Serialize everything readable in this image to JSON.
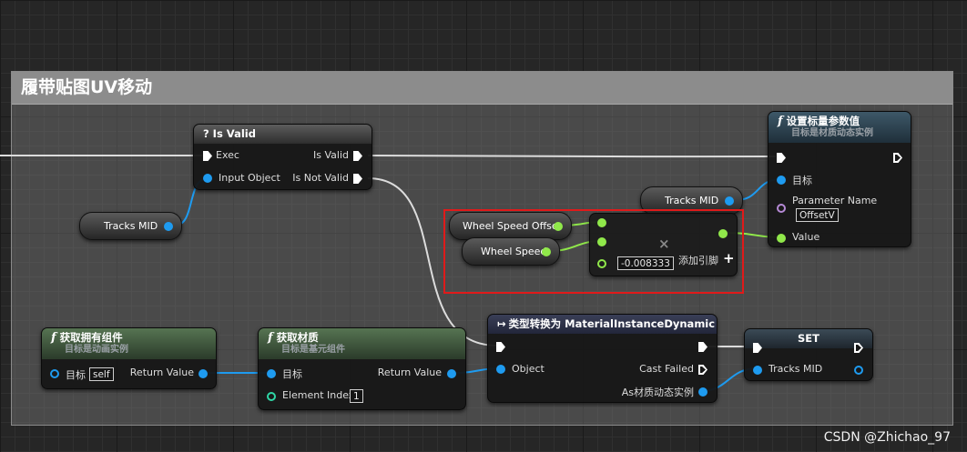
{
  "comment": {
    "title": "履带贴图UV移动"
  },
  "is_valid": {
    "title": "? Is Valid",
    "exec": "Exec",
    "is_valid": "Is Valid",
    "input_object": "Input Object",
    "is_not_valid": "Is Not Valid"
  },
  "var_tracks_mid_left": {
    "label": "Tracks MID"
  },
  "var_tracks_mid_top": {
    "label": "Tracks MID"
  },
  "set_scalar": {
    "title": "设置标量参数值",
    "subtitle": "目标是材质动态实例",
    "target": "目标",
    "parameter_name": "Parameter Name",
    "parameter_value": "OffsetV",
    "value": "Value"
  },
  "wheel_speed_offset": {
    "label": "Wheel Speed Offset"
  },
  "wheel_speed": {
    "label": "Wheel Speed"
  },
  "multiply": {
    "constant": "-0.008333",
    "add_pin": "添加引脚",
    "add_icon": "+",
    "operator": "×"
  },
  "get_owner": {
    "title": "获取拥有组件",
    "subtitle": "目标是动画实例",
    "target": "目标",
    "target_value": "self",
    "return_value": "Return Value"
  },
  "get_material": {
    "title": "获取材质",
    "subtitle": "目标是基元组件",
    "target": "目标",
    "element_index": "Element Index",
    "element_index_value": "1",
    "return_value": "Return Value"
  },
  "cast": {
    "title": "类型转换为 MaterialInstanceDynamic",
    "object": "Object",
    "cast_failed": "Cast Failed",
    "as_instance": "As材质动态实例"
  },
  "set_node": {
    "title": "SET",
    "tracks_mid": "Tracks MID"
  },
  "watermark": "CSDN @Zhichao_97",
  "colors": {
    "object_pin": "#1e9bf0",
    "float_pin": "#90e84a",
    "name_pin": "#b68ad6",
    "exec_wire": "#ffffff",
    "highlight": "#e01a1a"
  }
}
